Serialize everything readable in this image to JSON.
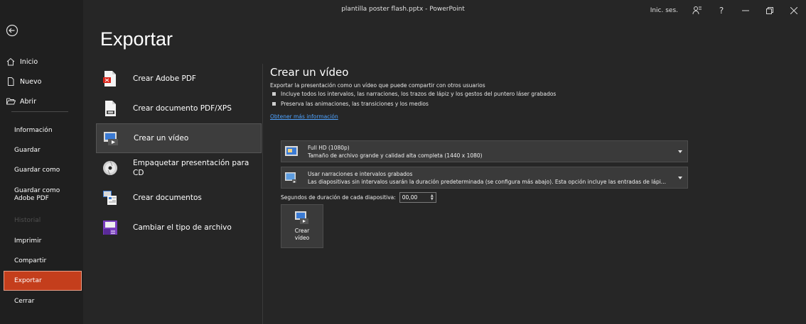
{
  "window": {
    "title": "plantilla poster flash.pptx  -  PowerPoint",
    "signin": "Inic. ses."
  },
  "nav": {
    "top": [
      {
        "label": "Inicio",
        "icon": "home-icon"
      },
      {
        "label": "Nuevo",
        "icon": "new-document-icon"
      },
      {
        "label": "Abrir",
        "icon": "folder-open-icon"
      }
    ],
    "bottom": [
      {
        "label": "Información",
        "state": "normal"
      },
      {
        "label": "Guardar",
        "state": "normal"
      },
      {
        "label": "Guardar como",
        "state": "normal"
      },
      {
        "label": "Guardar como Adobe PDF",
        "state": "normal"
      },
      {
        "label": "Historial",
        "state": "disabled"
      },
      {
        "label": "Imprimir",
        "state": "normal"
      },
      {
        "label": "Compartir",
        "state": "normal"
      },
      {
        "label": "Exportar",
        "state": "active"
      },
      {
        "label": "Cerrar",
        "state": "normal"
      }
    ]
  },
  "page": {
    "title": "Exportar"
  },
  "options": [
    {
      "label": "Crear Adobe PDF",
      "icon": "adobe-pdf-icon"
    },
    {
      "label": "Crear documento PDF/XPS",
      "icon": "pdf-xps-icon"
    },
    {
      "label": "Crear un vídeo",
      "icon": "video-icon",
      "selected": true
    },
    {
      "label": "Empaquetar presentación para CD",
      "icon": "cd-icon"
    },
    {
      "label": "Crear documentos",
      "icon": "handouts-icon"
    },
    {
      "label": "Cambiar el tipo de archivo",
      "icon": "change-file-type-icon"
    }
  ],
  "panel": {
    "title": "Crear un vídeo",
    "description": "Exportar la presentación como un vídeo que puede compartir con otros usuarios",
    "bullets": [
      "Incluye todos los intervalos, las narraciones, los trazos de lápiz y los gestos del puntero láser grabados",
      "Preserva las animaciones, las transiciones y los medios"
    ],
    "link": "Obtener más información",
    "quality": {
      "title": "Full HD (1080p)",
      "subtitle": "Tamaño de archivo grande y calidad alta completa (1440 x 1080)"
    },
    "narration": {
      "title": "Usar narraciones e intervalos grabados",
      "subtitle": "Las diapositivas sin intervalos usarán la duración predeterminada (se configura más abajo). Esta opción incluye las entradas de lápi..."
    },
    "seconds_label": "Segundos de duración de cada diapositiva:",
    "seconds_value": "00,00",
    "create_button": "Crear vídeo"
  },
  "colors": {
    "accent": "#c43e1c",
    "background": "#262626",
    "sidebar": "#1f1f1f",
    "link": "#4fa3ff"
  }
}
